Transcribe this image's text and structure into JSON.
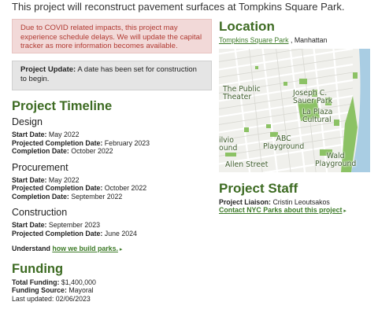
{
  "intro": "This project will reconstruct pavement surfaces at Tompkins Square Park.",
  "alert": "Due to COVID related impacts, this project may experience schedule delays. We will update the capital tracker as more information becomes available.",
  "update": {
    "label": "Project Update:",
    "text": " A date has been set for construction to begin."
  },
  "timeline": {
    "title": "Project Timeline",
    "design": {
      "title": "Design",
      "start_label": "Start Date:",
      "start": " May 2022",
      "projected_label": "Projected Completion Date:",
      "projected": " February 2023",
      "completion_label": "Completion Date:",
      "completion": " October 2022"
    },
    "procurement": {
      "title": "Procurement",
      "start_label": "Start Date:",
      "start": " May 2022",
      "projected_label": "Projected Completion Date:",
      "projected": " October 2022",
      "completion_label": "Completion Date:",
      "completion": " September 2022"
    },
    "construction": {
      "title": "Construction",
      "start_label": "Start Date:",
      "start": " September 2023",
      "projected_label": "Projected Completion Date:",
      "projected": " June 2024"
    },
    "understand_prefix": "Understand ",
    "understand_link": "how we build parks."
  },
  "funding": {
    "title": "Funding",
    "total_label": "Total Funding:",
    "total": " $1,400,000",
    "source_label": "Funding Source:",
    "source": " Mayoral",
    "updated": "Last updated: 02/06/2023"
  },
  "location": {
    "title": "Location",
    "park_link": "Tompkins Square Park",
    "borough": " , Manhattan",
    "map_labels": {
      "public_theater_1": "The Public",
      "public_theater_2": "Theater",
      "sauer_1": "Joseph C.",
      "sauer_2": "Sauer Park",
      "la_plaza_1": "La Plaza",
      "la_plaza_2": "Cultural",
      "abc_1": "ABC",
      "abc_2": "Playground",
      "wald_1": "Wald",
      "wald_2": "Playground",
      "silvio": "ilvio",
      "ound": "ound",
      "allen": "Allen Street"
    }
  },
  "staff": {
    "title": "Project Staff",
    "liaison_label": "Project Liaison:",
    "liaison": " Cristin Leoutsakos",
    "contact_link": "Contact NYC Parks about this project"
  },
  "colors": {
    "heading_green": "#3d6b22",
    "link_green": "#3d7b28",
    "alert_bg": "#f2d9d8",
    "alert_text": "#b03a32",
    "update_bg": "#e5e5e5",
    "park_green": "#8cc265",
    "water": "#a9cde3"
  }
}
